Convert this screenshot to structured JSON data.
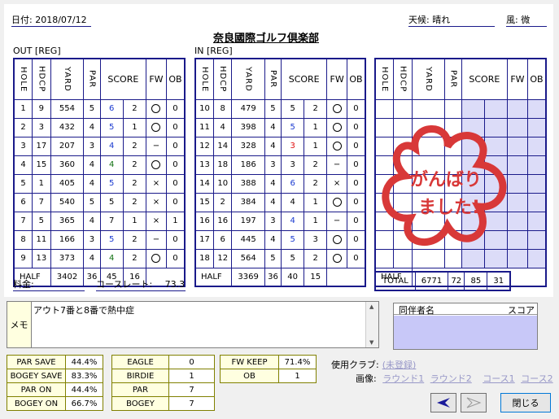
{
  "header": {
    "date_label": "日付:",
    "date_value": "2018/07/12",
    "weather_label": "天候:",
    "weather_value": "晴れ",
    "wind_label": "風:",
    "wind_value": "微",
    "course_name": "奈良國際ゴルフ倶楽部"
  },
  "out": {
    "label": "OUT [REG]",
    "cols": [
      "HOLE",
      "HDCP",
      "YARD",
      "PAR",
      "SCORE",
      "FW",
      "OB"
    ],
    "rows": [
      {
        "hole": "1",
        "hdcp": "9",
        "yard": "554",
        "par": "5",
        "score": "6",
        "putt": "2",
        "fw": "○",
        "ob": "0",
        "color": "blue"
      },
      {
        "hole": "2",
        "hdcp": "3",
        "yard": "432",
        "par": "4",
        "score": "5",
        "putt": "1",
        "fw": "○",
        "ob": "0",
        "color": "blue"
      },
      {
        "hole": "3",
        "hdcp": "17",
        "yard": "207",
        "par": "3",
        "score": "4",
        "putt": "2",
        "fw": "−",
        "ob": "0",
        "color": "blue"
      },
      {
        "hole": "4",
        "hdcp": "15",
        "yard": "360",
        "par": "4",
        "score": "4",
        "putt": "2",
        "fw": "○",
        "ob": "0",
        "color": "green"
      },
      {
        "hole": "5",
        "hdcp": "1",
        "yard": "405",
        "par": "4",
        "score": "5",
        "putt": "2",
        "fw": "×",
        "ob": "0",
        "color": "blue"
      },
      {
        "hole": "6",
        "hdcp": "7",
        "yard": "540",
        "par": "5",
        "score": "5",
        "putt": "2",
        "fw": "×",
        "ob": "0",
        "color": "black"
      },
      {
        "hole": "7",
        "hdcp": "5",
        "yard": "365",
        "par": "4",
        "score": "7",
        "putt": "1",
        "fw": "×",
        "ob": "1",
        "color": "bold"
      },
      {
        "hole": "8",
        "hdcp": "11",
        "yard": "166",
        "par": "3",
        "score": "5",
        "putt": "2",
        "fw": "−",
        "ob": "0",
        "color": "blue"
      },
      {
        "hole": "9",
        "hdcp": "13",
        "yard": "373",
        "par": "4",
        "score": "4",
        "putt": "2",
        "fw": "○",
        "ob": "0",
        "color": "green"
      }
    ],
    "half": {
      "label": "HALF",
      "yard": "3402",
      "par": "36",
      "score": "45",
      "putt": "16"
    }
  },
  "in": {
    "label": "IN [REG]",
    "cols": [
      "HOLE",
      "HDCP",
      "YARD",
      "PAR",
      "SCORE",
      "FW",
      "OB"
    ],
    "rows": [
      {
        "hole": "10",
        "hdcp": "8",
        "yard": "479",
        "par": "5",
        "score": "5",
        "putt": "2",
        "fw": "○",
        "ob": "0",
        "color": "black"
      },
      {
        "hole": "11",
        "hdcp": "4",
        "yard": "398",
        "par": "4",
        "score": "5",
        "putt": "1",
        "fw": "○",
        "ob": "0",
        "color": "blue"
      },
      {
        "hole": "12",
        "hdcp": "14",
        "yard": "328",
        "par": "4",
        "score": "3",
        "putt": "1",
        "fw": "○",
        "ob": "0",
        "color": "red"
      },
      {
        "hole": "13",
        "hdcp": "18",
        "yard": "186",
        "par": "3",
        "score": "3",
        "putt": "2",
        "fw": "−",
        "ob": "0",
        "color": "black"
      },
      {
        "hole": "14",
        "hdcp": "10",
        "yard": "388",
        "par": "4",
        "score": "6",
        "putt": "2",
        "fw": "×",
        "ob": "0",
        "color": "blue"
      },
      {
        "hole": "15",
        "hdcp": "2",
        "yard": "384",
        "par": "4",
        "score": "4",
        "putt": "1",
        "fw": "○",
        "ob": "0",
        "color": "black"
      },
      {
        "hole": "16",
        "hdcp": "16",
        "yard": "197",
        "par": "3",
        "score": "4",
        "putt": "1",
        "fw": "−",
        "ob": "0",
        "color": "blue"
      },
      {
        "hole": "17",
        "hdcp": "6",
        "yard": "445",
        "par": "4",
        "score": "5",
        "putt": "3",
        "fw": "○",
        "ob": "0",
        "color": "blue"
      },
      {
        "hole": "18",
        "hdcp": "12",
        "yard": "564",
        "par": "5",
        "score": "5",
        "putt": "2",
        "fw": "○",
        "ob": "0",
        "color": "black"
      }
    ],
    "half": {
      "label": "HALF",
      "yard": "3369",
      "par": "36",
      "score": "40",
      "putt": "15"
    }
  },
  "extra": {
    "cols": [
      "HOLE",
      "HDCP",
      "YARD",
      "PAR",
      "SCORE",
      "FW",
      "OB"
    ],
    "half_label": "HALF",
    "total": {
      "label": "TOTAL",
      "yard": "6771",
      "par": "72",
      "score": "85",
      "putt": "31"
    },
    "stamp_line1": "がんばり",
    "stamp_line2": "ました!",
    "stamp_color": "#d83838"
  },
  "fee": {
    "label": "料金:",
    "value": ""
  },
  "rating": {
    "label": "コースレート:",
    "value": "73.3"
  },
  "memo": {
    "label": "メモ",
    "text": "アウト7番と8番で熱中症"
  },
  "companions": {
    "name_header": "同伴者名",
    "score_header": "スコア"
  },
  "stats": {
    "col1": [
      [
        "PAR SAVE",
        "44.4%"
      ],
      [
        "BOGEY SAVE",
        "83.3%"
      ],
      [
        "PAR ON",
        "44.4%"
      ],
      [
        "BOGEY ON",
        "66.7%"
      ]
    ],
    "col2": [
      [
        "EAGLE",
        "0"
      ],
      [
        "BIRDIE",
        "1"
      ],
      [
        "PAR",
        "7"
      ],
      [
        "BOGEY",
        "7"
      ]
    ],
    "col3": [
      [
        "FW KEEP",
        "71.4%"
      ],
      [
        "OB",
        "1"
      ]
    ]
  },
  "clubs": {
    "label": "使用クラブ:",
    "link": "(未登録)",
    "image_label": "画像:",
    "links": [
      "ラウンド1",
      "ラウンド2",
      "コース1",
      "コース2"
    ]
  },
  "buttons": {
    "close": "閉じる"
  },
  "colors": {
    "grid": "#1a1a8a",
    "shaded": "#dcdcf8",
    "companion_bg": "#c8c8f8"
  }
}
